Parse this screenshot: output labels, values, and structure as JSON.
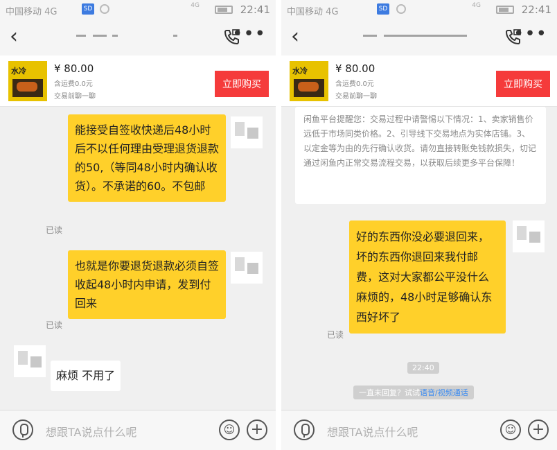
{
  "status": {
    "carrier": "中国移动 4G",
    "sim_label": "SD",
    "network": "4G",
    "time": "22:41"
  },
  "product": {
    "thumb_text": "水冷",
    "price": "¥ 80.00",
    "shipping": "含运费0.0元",
    "chat_hint": "交易前聊一聊",
    "buy_label": "立即购买"
  },
  "left_chat": {
    "msg1": "能接受自签收快递后48小时后不以任何理由受理退货退款的50,（等同48小时内确认收货）。不承诺的60。不包邮",
    "msg2": "也就是你要退货退款必须自签收起48小时内申请，发到付回来",
    "msg3": "麻烦 不用了",
    "read_label": "已读"
  },
  "right_chat": {
    "notice": "闲鱼平台提醒您：交易过程中请警惕以下情况：1、卖家销售价远低于市场同类价格。2、引导线下交易地点为实体店铺。3、以定金等为由的先行确认收货。请勿直接转账免钱款损失，切记通过闲鱼内正常交易流程交易，以获取后续更多平台保障！",
    "msg1": "好的东西你没必要退回来，坏的东西你退回来我付邮费，这对大家都公平没什么麻烦的，48小时足够确认东西好坏了",
    "read_label": "已读",
    "timestamp": "22:40",
    "reply_hint_prefix": "一直未回复？试试",
    "reply_hint_link": "语音/视频通话"
  },
  "input": {
    "placeholder": "想跟TA说点什么呢"
  },
  "icons": {
    "back": "back-arrow-icon",
    "call": "phone-video-icon",
    "more": "more-dots-icon",
    "mic": "microphone-icon",
    "emoji": "emoji-icon",
    "plus": "plus-icon"
  },
  "colors": {
    "accent_yellow": "#ffd02a",
    "buy_red": "#f53b3b",
    "link_blue": "#3f8df0"
  }
}
